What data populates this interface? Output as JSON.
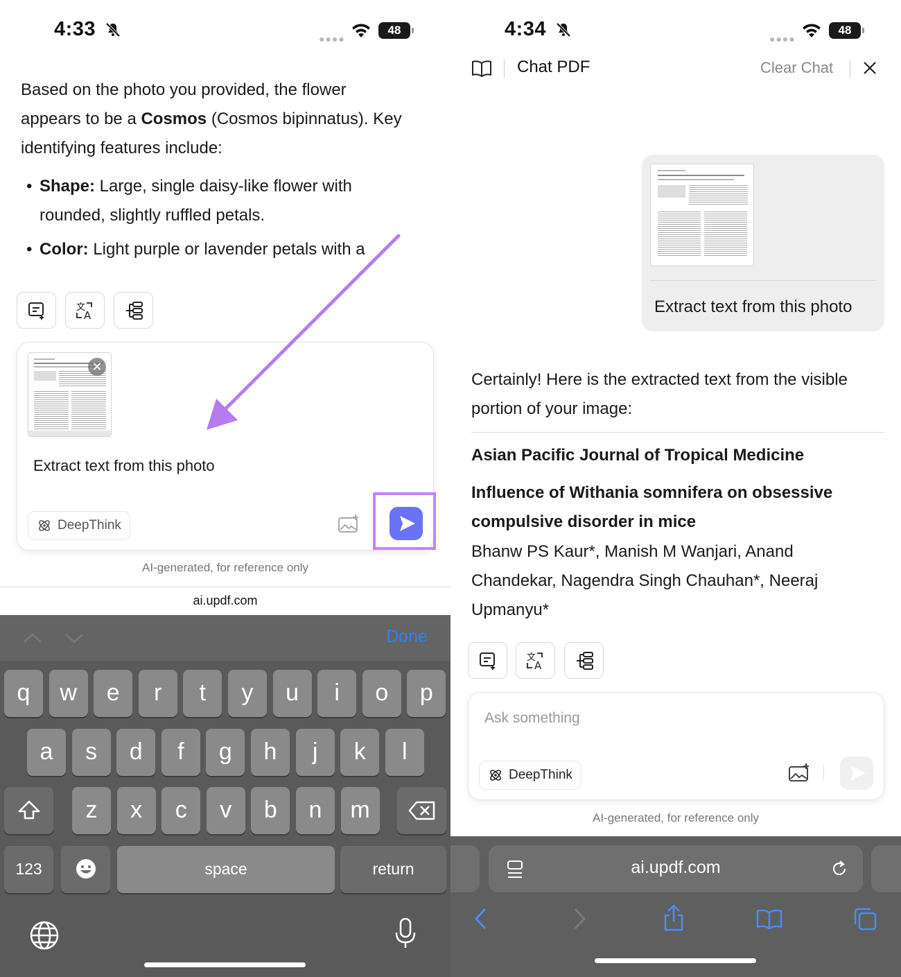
{
  "left": {
    "status": {
      "time": "4:33",
      "battery": "48"
    },
    "answer": {
      "para1_a": "Based on the photo you provided, the flower",
      "para1_b_pre": "appears to be a ",
      "para1_b_bold": "Cosmos",
      "para1_b_post": " (Cosmos bipinnatus). Key",
      "para1_c": "identifying features include:",
      "bullet1_bold": "Shape:",
      "bullet1_text": " Large, single daisy-like flower with",
      "bullet1_cont": "rounded, slightly ruffled petals.",
      "bullet2_bold": "Color:",
      "bullet2_text": " Light purple or lavender petals with a"
    },
    "composer": {
      "prompt_text": "Extract text from this photo",
      "deepthink_label": "DeepThink"
    },
    "disclaimer": "AI-generated, for reference only",
    "url": "ai.updf.com",
    "keyboard": {
      "done_label": "Done",
      "row1": [
        "q",
        "w",
        "e",
        "r",
        "t",
        "y",
        "u",
        "i",
        "o",
        "p"
      ],
      "row2": [
        "a",
        "s",
        "d",
        "f",
        "g",
        "h",
        "j",
        "k",
        "l"
      ],
      "row3": [
        "z",
        "x",
        "c",
        "v",
        "b",
        "n",
        "m"
      ],
      "num_label": "123",
      "space_label": "space",
      "return_label": "return"
    }
  },
  "right": {
    "status": {
      "time": "4:34",
      "battery": "48"
    },
    "header": {
      "title": "Chat PDF",
      "clear_label": "Clear Chat"
    },
    "user_message": "Extract text from this photo",
    "reply": {
      "intro_a": "Certainly! Here is the extracted text from the visible",
      "intro_b": "portion of your image:",
      "journal": "Asian Pacific Journal of Tropical Medicine",
      "title_a": "Influence of Withania somnifera on obsessive",
      "title_b": "compulsive disorder in mice",
      "authors_a": "Bhanw PS Kaur*, Manish M Wanjari, Anand",
      "authors_b": "Chandekar, Nagendra Singh Chauhan*, Neeraj",
      "authors_c": "Upmanyu*"
    },
    "composer": {
      "placeholder": "Ask something",
      "deepthink_label": "DeepThink"
    },
    "disclaimer": "AI-generated, for reference only",
    "url": "ai.updf.com"
  },
  "colors": {
    "accent": "#6a72f5",
    "highlight": "#c084fc",
    "link": "#2f7ff7",
    "safari_icons": "#4b8cf7"
  }
}
